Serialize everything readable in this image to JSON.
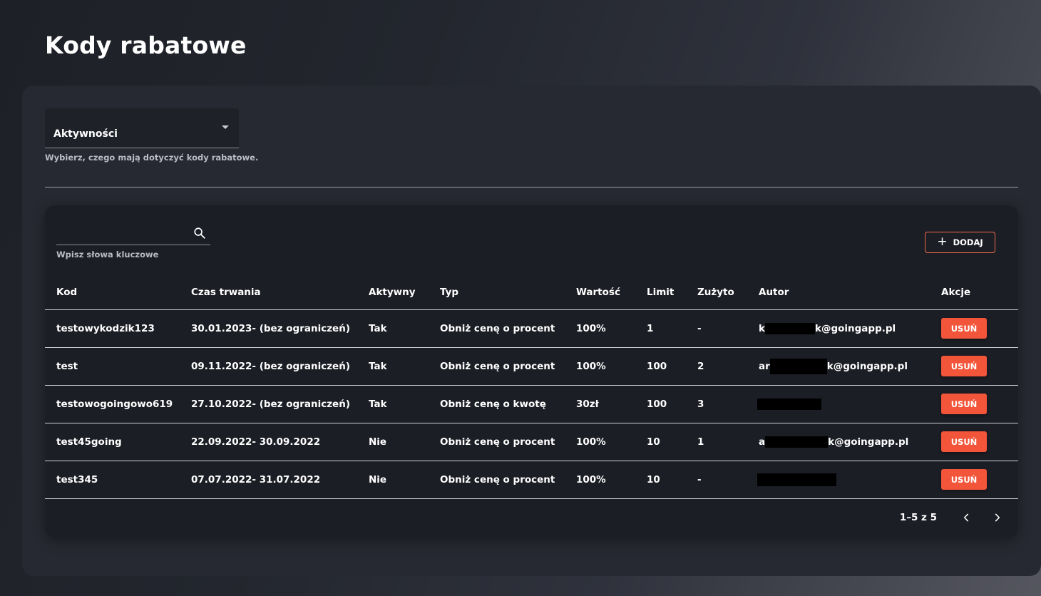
{
  "page": {
    "title": "Kody rabatowe"
  },
  "filter": {
    "selected": "Aktywności",
    "helper": "Wybierz, czego mają dotyczyć kody rabatowe."
  },
  "search": {
    "value": "",
    "helper": "Wpisz słowa kluczowe",
    "icon": "search-icon"
  },
  "toolbar": {
    "add_label": "DODAJ",
    "add_icon": "plus-icon"
  },
  "table": {
    "columns": [
      "Kod",
      "Czas trwania",
      "Aktywny",
      "Typ",
      "Wartość",
      "Limit",
      "Zużyto",
      "Autor",
      "Akcje"
    ],
    "rows": [
      {
        "code": "testowykodzik123",
        "duration": "30.01.2023- (bez ograniczeń)",
        "active": "Tak",
        "type": "Obniż cenę o procent",
        "value": "100%",
        "limit": "1",
        "used": "-",
        "author_prefix": "k",
        "author_suffix": "k@goingapp.pl",
        "action": "USUŃ"
      },
      {
        "code": "test",
        "duration": "09.11.2022- (bez ograniczeń)",
        "active": "Tak",
        "type": "Obniż cenę o procent",
        "value": "100%",
        "limit": "100",
        "used": "2",
        "author_prefix": "ar",
        "author_suffix": "k@goingapp.pl",
        "action": "USUŃ"
      },
      {
        "code": "testowogoingowo619",
        "duration": "27.10.2022- (bez ograniczeń)",
        "active": "Tak",
        "type": "Obniż cenę o kwotę",
        "value": "30zł",
        "limit": "100",
        "used": "3",
        "author_prefix": "",
        "author_suffix": "",
        "action": "USUŃ"
      },
      {
        "code": "test45going",
        "duration": "22.09.2022- 30.09.2022",
        "active": "Nie",
        "type": "Obniż cenę o procent",
        "value": "100%",
        "limit": "10",
        "used": "1",
        "author_prefix": "a",
        "author_suffix": "k@goingapp.pl",
        "action": "USUŃ"
      },
      {
        "code": "test345",
        "duration": "07.07.2022- 31.07.2022",
        "active": "Nie",
        "type": "Obniż cenę o procent",
        "value": "100%",
        "limit": "10",
        "used": "-",
        "author_prefix": "",
        "author_suffix": "",
        "action": "USUŃ"
      }
    ]
  },
  "pagination": {
    "info": "1–5 z 5",
    "prev_icon": "chevron-left-icon",
    "next_icon": "chevron-right-icon"
  },
  "colors": {
    "accent": "#f2553a",
    "card": "#262931",
    "panel": "#1c1e25"
  }
}
